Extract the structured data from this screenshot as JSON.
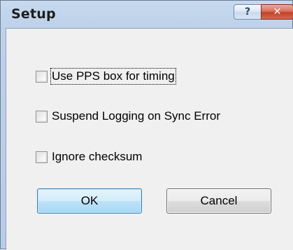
{
  "window": {
    "title": "Setup",
    "help_label": "?",
    "close_label": "✕"
  },
  "options": [
    {
      "label": "Use PPS box for timing",
      "checked": false
    },
    {
      "label": "Suspend Logging on Sync Error",
      "checked": false
    },
    {
      "label": "Ignore checksum",
      "checked": false
    }
  ],
  "buttons": {
    "ok_label": "OK",
    "cancel_label": "Cancel"
  },
  "icons": {
    "help": "help-icon",
    "close": "close-icon"
  },
  "colors": {
    "title_bar": "#bcd1ea",
    "client_bg": "#f0f0f0",
    "close_button": "#c2412a",
    "default_button": "#a7d9f5"
  }
}
